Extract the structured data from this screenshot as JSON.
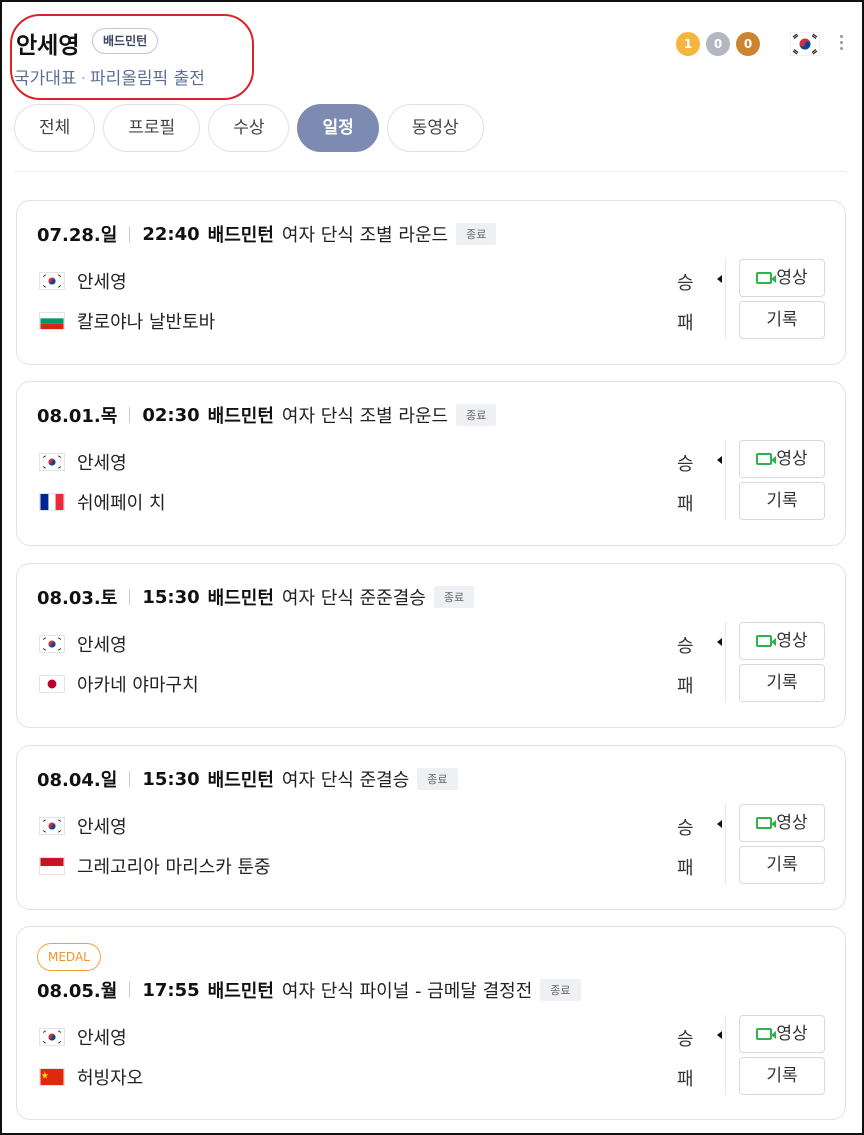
{
  "athlete": {
    "name": "안세영",
    "sport_tag": "배드민턴",
    "subtitle_team": "국가대표",
    "subtitle_sep": "·",
    "subtitle_event": "파리올림픽 출전",
    "medals": {
      "gold": "1",
      "silver": "0",
      "bronze": "0"
    },
    "country_flag": "korea-flag-icon"
  },
  "tabs": [
    {
      "label": "전체",
      "active": false
    },
    {
      "label": "프로필",
      "active": false
    },
    {
      "label": "수상",
      "active": false
    },
    {
      "label": "일정",
      "active": true
    },
    {
      "label": "동영상",
      "active": false
    }
  ],
  "matches": [
    {
      "date": "07.28.일",
      "time": "22:40",
      "sport": "배드민턴",
      "event": "여자 단식 조별 라운드",
      "status": "종료",
      "player1": {
        "name": "안세영",
        "flag": "korea-flag-icon",
        "result": "승"
      },
      "player2": {
        "name": "칼로야나 날반토바",
        "flag": "bulgaria-flag-icon",
        "result": "패"
      },
      "video_label": "영상",
      "record_label": "기록"
    },
    {
      "date": "08.01.목",
      "time": "02:30",
      "sport": "배드민턴",
      "event": "여자 단식 조별 라운드",
      "status": "종료",
      "player1": {
        "name": "안세영",
        "flag": "korea-flag-icon",
        "result": "승"
      },
      "player2": {
        "name": "쉬에페이 치",
        "flag": "france-flag-icon",
        "result": "패"
      },
      "video_label": "영상",
      "record_label": "기록"
    },
    {
      "date": "08.03.토",
      "time": "15:30",
      "sport": "배드민턴",
      "event": "여자 단식 준준결승",
      "status": "종료",
      "player1": {
        "name": "안세영",
        "flag": "korea-flag-icon",
        "result": "승"
      },
      "player2": {
        "name": "아카네 야마구치",
        "flag": "japan-flag-icon",
        "result": "패"
      },
      "video_label": "영상",
      "record_label": "기록"
    },
    {
      "date": "08.04.일",
      "time": "15:30",
      "sport": "배드민턴",
      "event": "여자 단식 준결승",
      "status": "종료",
      "player1": {
        "name": "안세영",
        "flag": "korea-flag-icon",
        "result": "승"
      },
      "player2": {
        "name": "그레고리아 마리스카 툰중",
        "flag": "indonesia-flag-icon",
        "result": "패"
      },
      "video_label": "영상",
      "record_label": "기록"
    },
    {
      "badge": "MEDAL",
      "date": "08.05.월",
      "time": "17:55",
      "sport": "배드민턴",
      "event": "여자 단식 파이널 - 금메달 결정전",
      "status": "종료",
      "player1": {
        "name": "안세영",
        "flag": "korea-flag-icon",
        "result": "승"
      },
      "player2": {
        "name": "허빙자오",
        "flag": "china-flag-icon",
        "result": "패"
      },
      "video_label": "영상",
      "record_label": "기록"
    }
  ],
  "colors": {
    "accent_tab": "#7d8bb2",
    "highlight_ring": "#d8232a",
    "video_green": "#2fb24b",
    "medal_badge": "#e8962e"
  }
}
